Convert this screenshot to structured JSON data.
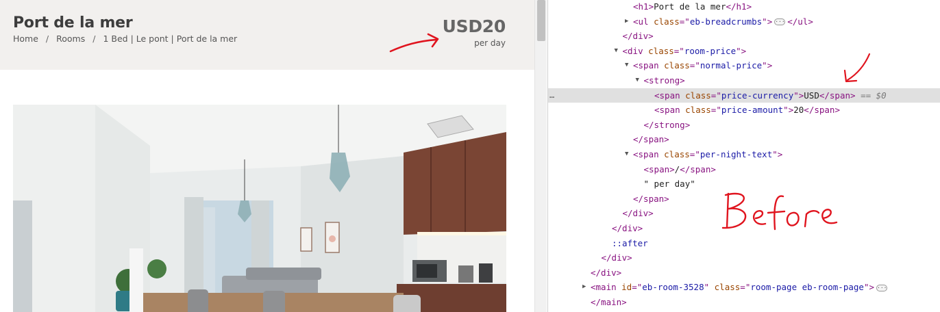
{
  "site": {
    "title": "Port de la mer",
    "breadcrumbs": [
      "Home",
      "Rooms",
      "1 Bed | Le pont | Port de la mer"
    ],
    "breadcrumb_separator": "/",
    "price": "USD20",
    "per_day": "per day"
  },
  "devtools": {
    "lines": [
      {
        "indent": 0,
        "twisty": "",
        "parts": [
          [
            "tag",
            "<h1>"
          ],
          [
            "txt",
            "Port de la mer"
          ],
          [
            "tag",
            "</h1>"
          ]
        ]
      },
      {
        "indent": 0,
        "twisty": "▶",
        "parts": [
          [
            "tag",
            "<ul "
          ],
          [
            "attr",
            "class"
          ],
          [
            "tag",
            "=\""
          ],
          [
            "val",
            "eb-breadcrumbs"
          ],
          [
            "tag",
            "\">"
          ],
          [
            "pill",
            ""
          ],
          [
            "tag",
            "</ul>"
          ]
        ]
      },
      {
        "indent": -1,
        "twisty": "",
        "parts": [
          [
            "tag",
            "</div>"
          ]
        ]
      },
      {
        "indent": -1,
        "twisty": "▼",
        "parts": [
          [
            "tag",
            "<div "
          ],
          [
            "attr",
            "class"
          ],
          [
            "tag",
            "=\""
          ],
          [
            "val",
            "room-price"
          ],
          [
            "tag",
            "\">"
          ]
        ]
      },
      {
        "indent": 0,
        "twisty": "▼",
        "parts": [
          [
            "tag",
            "<span "
          ],
          [
            "attr",
            "class"
          ],
          [
            "tag",
            "=\""
          ],
          [
            "val",
            "normal-price"
          ],
          [
            "tag",
            "\">"
          ]
        ]
      },
      {
        "indent": 1,
        "twisty": "▼",
        "parts": [
          [
            "tag",
            "<strong>"
          ]
        ]
      },
      {
        "indent": 2,
        "twisty": "",
        "selected": true,
        "parts": [
          [
            "tag",
            "<span "
          ],
          [
            "attr",
            "class"
          ],
          [
            "tag",
            "=\""
          ],
          [
            "val",
            "price-currency"
          ],
          [
            "tag",
            "\">"
          ],
          [
            "txt",
            "USD"
          ],
          [
            "tag",
            "</span>"
          ],
          [
            "eq",
            " == $0"
          ]
        ]
      },
      {
        "indent": 2,
        "twisty": "",
        "parts": [
          [
            "tag",
            "<span "
          ],
          [
            "attr",
            "class"
          ],
          [
            "tag",
            "=\""
          ],
          [
            "val",
            "price-amount"
          ],
          [
            "tag",
            "\">"
          ],
          [
            "txt",
            "20"
          ],
          [
            "tag",
            "</span>"
          ]
        ]
      },
      {
        "indent": 1,
        "twisty": "",
        "parts": [
          [
            "tag",
            "</strong>"
          ]
        ]
      },
      {
        "indent": 0,
        "twisty": "",
        "parts": [
          [
            "tag",
            "</span>"
          ]
        ]
      },
      {
        "indent": 0,
        "twisty": "▼",
        "parts": [
          [
            "tag",
            "<span "
          ],
          [
            "attr",
            "class"
          ],
          [
            "tag",
            "=\""
          ],
          [
            "val",
            "per-night-text"
          ],
          [
            "tag",
            "\">"
          ]
        ]
      },
      {
        "indent": 1,
        "twisty": "",
        "parts": [
          [
            "tag",
            "<span>"
          ],
          [
            "txt",
            "/"
          ],
          [
            "tag",
            "</span>"
          ]
        ]
      },
      {
        "indent": 1,
        "twisty": "",
        "parts": [
          [
            "txt",
            "\" per day\""
          ]
        ]
      },
      {
        "indent": 0,
        "twisty": "",
        "parts": [
          [
            "tag",
            "</span>"
          ]
        ]
      },
      {
        "indent": -1,
        "twisty": "",
        "parts": [
          [
            "tag",
            "</div>"
          ]
        ]
      },
      {
        "indent": -2,
        "twisty": "",
        "parts": [
          [
            "tag",
            "</div>"
          ]
        ]
      },
      {
        "indent": -2,
        "twisty": "",
        "parts": [
          [
            "pseudo",
            "::after"
          ]
        ]
      },
      {
        "indent": -3,
        "twisty": "",
        "parts": [
          [
            "tag",
            "</div>"
          ]
        ]
      },
      {
        "indent": -4,
        "twisty": "",
        "parts": [
          [
            "tag",
            "</div>"
          ]
        ]
      },
      {
        "indent": -4,
        "twisty": "▶",
        "parts": [
          [
            "tag",
            "<main "
          ],
          [
            "attr",
            "id"
          ],
          [
            "tag",
            "=\""
          ],
          [
            "val",
            "eb-room-3528"
          ],
          [
            "tag",
            "\" "
          ],
          [
            "attr",
            "class"
          ],
          [
            "tag",
            "=\""
          ],
          [
            "val",
            "room-page eb-room-page"
          ],
          [
            "tag",
            "\">"
          ],
          [
            "pill",
            ""
          ]
        ]
      },
      {
        "indent": -4,
        "twisty": "",
        "parts": [
          [
            "tag",
            "</main>"
          ]
        ]
      }
    ],
    "selected_marker": "…"
  },
  "annotation": {
    "handwritten_note": "Before",
    "ink_color": "#e0141e"
  },
  "colors": {
    "header_bg": "#f2f0ee",
    "price_color": "#666666",
    "tag": "#881280",
    "attr": "#994500",
    "value": "#1a1aa6",
    "selection_bg": "#e0e0e0"
  }
}
